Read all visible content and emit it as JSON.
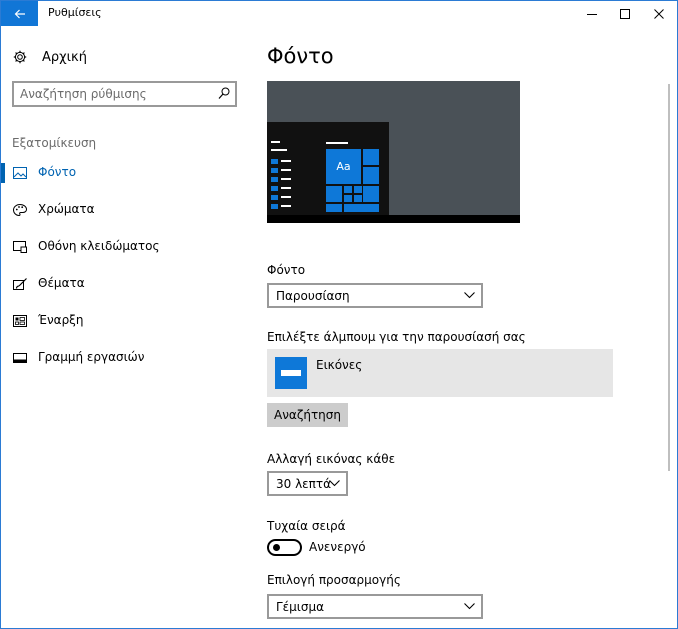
{
  "window": {
    "title": "Ρυθμίσεις"
  },
  "sidebar": {
    "home_label": "Αρχική",
    "search_placeholder": "Αναζήτηση ρύθμισης",
    "section_label": "Εξατομίκευση",
    "items": [
      {
        "label": "Φόντο",
        "icon": "picture-icon",
        "active": true
      },
      {
        "label": "Χρώματα",
        "icon": "palette-icon",
        "active": false
      },
      {
        "label": "Οθόνη κλειδώματος",
        "icon": "lock-screen-icon",
        "active": false
      },
      {
        "label": "Θέματα",
        "icon": "brush-icon",
        "active": false
      },
      {
        "label": "Έναρξη",
        "icon": "start-tiles-icon",
        "active": false
      },
      {
        "label": "Γραμμή εργασιών",
        "icon": "taskbar-icon",
        "active": false
      }
    ]
  },
  "main": {
    "title": "Φόντο",
    "preview_tile_label": "Aa",
    "background": {
      "label": "Φόντο",
      "value": "Παρουσίαση"
    },
    "album": {
      "label": "Επιλέξτε άλμπουμ για την παρουσίασή σας",
      "folder_name": "Εικόνες",
      "browse_label": "Αναζήτηση"
    },
    "interval": {
      "label": "Αλλαγή εικόνας κάθε",
      "value": "30 λεπτά"
    },
    "shuffle": {
      "label": "Τυχαία σειρά",
      "state_label": "Ανενεργό",
      "on": false
    },
    "fit": {
      "label": "Επιλογή προσαρμογής",
      "value": "Γέμισμα"
    }
  },
  "colors": {
    "accent": "#0063b1",
    "tile_blue": "#0e78d8",
    "title_back_button": "#1176d6"
  }
}
